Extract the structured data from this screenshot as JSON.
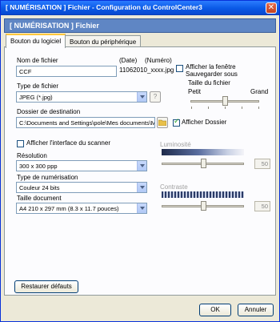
{
  "window": {
    "title": "[  NUMÉRISATION  ]   Fichier - Configuration du ControlCenter3",
    "close_glyph": "✕"
  },
  "header": {
    "title": "[  NUMÉRISATION  ]  Fichier"
  },
  "tabs": [
    {
      "label": "Bouton du logiciel",
      "active": true
    },
    {
      "label": "Bouton du périphérique",
      "active": false
    }
  ],
  "file": {
    "name_label": "Nom de fichier",
    "name_value": "CCF",
    "date_label": "(Date)",
    "number_label": "(Numéro)",
    "preview": "11062010_xxxx.jpg",
    "show_saveas_label_1": "Afficher la fenêtre",
    "show_saveas_label_2": "Sauvegarder sous",
    "show_saveas_checked": false
  },
  "file_type": {
    "label": "Type de fichier",
    "value": "JPEG (*.jpg)"
  },
  "file_size": {
    "label": "Taille du fichier",
    "small": "Petit",
    "large": "Grand",
    "level": 0.5
  },
  "destination": {
    "label": "Dossier de destination",
    "value": "C:\\Documents and Settings\\pole\\Mes documents\\Me",
    "show_folder_label": "Afficher Dossier",
    "show_folder_checked": true
  },
  "scanner": {
    "show_interface_label": "Afficher l'interface du scanner",
    "show_interface_checked": false,
    "resolution_label": "Résolution",
    "resolution_value": "300 x 300 ppp",
    "scan_type_label": "Type de numérisation",
    "scan_type_value": "Couleur 24 bits",
    "doc_size_label": "Taille document",
    "doc_size_value": "A4 210 x 297 mm (8.3 x 11.7 pouces)"
  },
  "brightness": {
    "label": "Luminosité",
    "value": "50",
    "level": 0.5
  },
  "contrast": {
    "label": "Contraste",
    "value": "50",
    "level": 0.5
  },
  "buttons": {
    "restore": "Restaurer défauts",
    "ok": "OK",
    "cancel": "Annuler"
  },
  "colors": {
    "title_bar": "#0a59e6",
    "header_bar": "#5f86c4",
    "dialog_bg": "#ece9d8"
  },
  "icons": {
    "browse": "folder-icon",
    "help": "question-icon"
  }
}
